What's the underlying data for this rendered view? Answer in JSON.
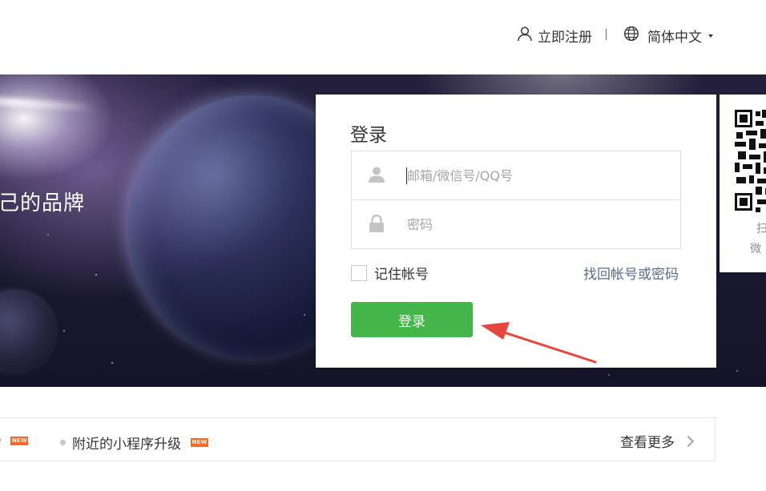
{
  "header": {
    "register_label": "立即注册",
    "language_label": "简体中文",
    "icons": {
      "register": "user-icon",
      "language": "globe-icon",
      "dropdown": "caret-down-icon"
    }
  },
  "banner": {
    "slogan": "己的品牌"
  },
  "login": {
    "title": "登录",
    "account_placeholder": "邮箱/微信号/QQ号",
    "account_value": "",
    "password_placeholder": "密码",
    "password_value": "",
    "remember_label": "记住帐号",
    "remember_checked": false,
    "recover_link": "找回帐号或密码",
    "submit_label": "登录",
    "icons": {
      "account": "user-icon",
      "password": "lock-icon"
    },
    "colors": {
      "submit_bg": "#44b549",
      "link": "#576b95",
      "annotation_arrow": "#e8453c"
    }
  },
  "qr": {
    "line1": "扫",
    "line2": "微"
  },
  "news": {
    "items": [
      {
        "text": "e",
        "badge": "NEW"
      },
      {
        "text": "附近的小程序升级",
        "badge": "NEW"
      }
    ],
    "more_label": "查看更多"
  }
}
